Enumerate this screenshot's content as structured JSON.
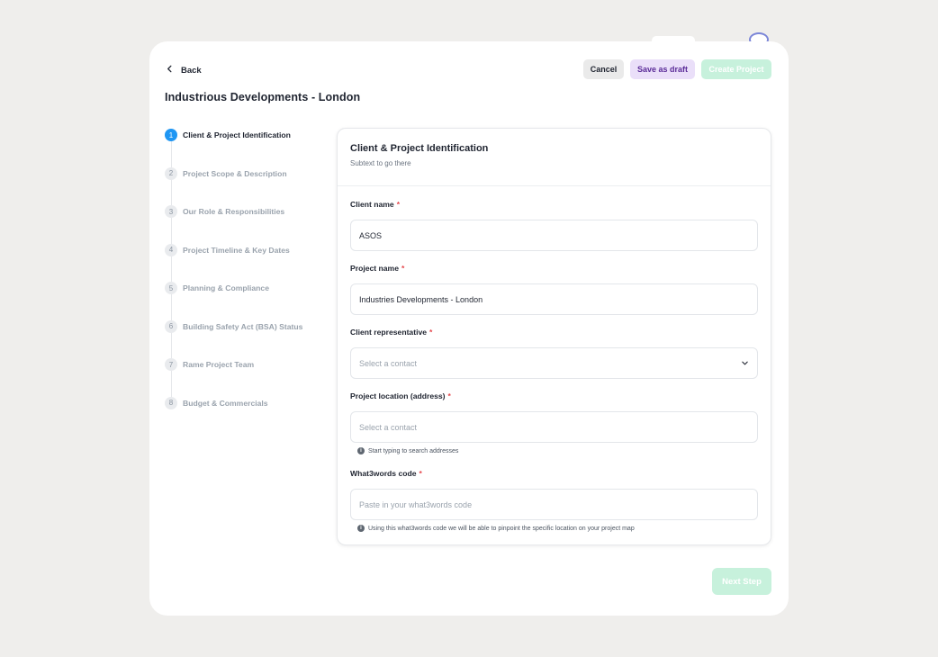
{
  "header": {
    "back_label": "Back",
    "cancel_label": "Cancel",
    "draft_label": "Save as draft",
    "create_label": "Create Project",
    "title": "Industrious Developments - London"
  },
  "steps": [
    {
      "num": "1",
      "label": "Client & Project Identification",
      "active": true
    },
    {
      "num": "2",
      "label": "Project Scope & Description",
      "active": false
    },
    {
      "num": "3",
      "label": "Our Role & Responsibilities",
      "active": false
    },
    {
      "num": "4",
      "label": "Project Timeline & Key Dates",
      "active": false
    },
    {
      "num": "5",
      "label": "Planning & Compliance",
      "active": false
    },
    {
      "num": "6",
      "label": "Building Safety Act (BSA) Status",
      "active": false
    },
    {
      "num": "7",
      "label": "Rame Project Team",
      "active": false
    },
    {
      "num": "8",
      "label": "Budget & Commercials",
      "active": false
    }
  ],
  "form": {
    "title": "Client & Project Identification",
    "subtitle": "Subtext to go there",
    "required_mark": "*",
    "client_name": {
      "label": "Client name",
      "value": "ASOS"
    },
    "project_name": {
      "label": "Project name",
      "value": "Industries Developments - London"
    },
    "client_rep": {
      "label": "Client representative",
      "placeholder": "Select a contact"
    },
    "location": {
      "label": "Project location (address)",
      "placeholder": "Select a contact",
      "hint": "Start typing to search addresses"
    },
    "w3w": {
      "label": "What3words code",
      "placeholder": "Paste in your what3words code",
      "hint": "Using this what3words code we will be able to pinpoint the specific location on your project map"
    }
  },
  "footer": {
    "next_label": "Next Step"
  },
  "icons": {
    "back": "chevron-left-icon",
    "dropdown": "chevron-down-icon",
    "info": "info-icon"
  },
  "colors": {
    "accent_blue": "#1f96f3",
    "primary_green_disabled": "#c7f1dc",
    "draft_purple_bg": "#eadff9",
    "required_red": "#e5484d"
  }
}
